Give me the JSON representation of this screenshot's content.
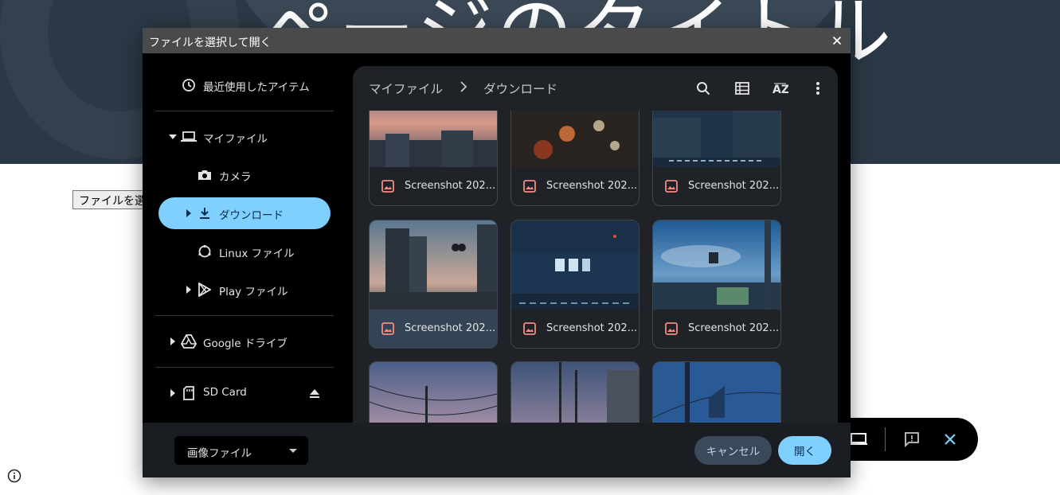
{
  "background_page": {
    "title": "ページのタイトル",
    "file_button_label": "ファイルを選択"
  },
  "dialog": {
    "title": "ファイルを選択して開く",
    "sidebar": {
      "recent": "最近使用したアイテム",
      "my_files": "マイファイル",
      "camera": "カメラ",
      "downloads": "ダウンロード",
      "linux_files": "Linux ファイル",
      "play_files": "Play ファイル",
      "google_drive": "Google ドライブ",
      "sd_card": "SD Card"
    },
    "breadcrumb": [
      "マイファイル",
      "ダウンロード"
    ],
    "files": [
      {
        "name": "Screenshot 202..."
      },
      {
        "name": "Screenshot 202..."
      },
      {
        "name": "Screenshot 202..."
      },
      {
        "name": "Screenshot 202..."
      },
      {
        "name": "Screenshot 202..."
      },
      {
        "name": "Screenshot 202..."
      }
    ],
    "file_type_filter": "画像ファイル",
    "cancel_label": "キャンセル",
    "open_label": "開く"
  },
  "colors": {
    "accent": "#7fcfff",
    "image_icon": "#f28b82",
    "panel": "#1f2226"
  },
  "icons": {
    "toolbar": [
      "search-icon",
      "grid-view-icon",
      "sort-az-icon",
      "more-vert-icon"
    ],
    "capture_bar": [
      "screen-icon",
      "feedback-icon",
      "close-icon"
    ]
  }
}
